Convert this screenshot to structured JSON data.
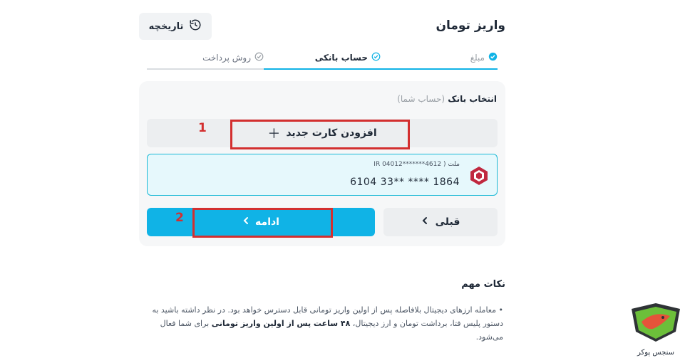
{
  "page": {
    "title": "واریز تومان"
  },
  "header": {
    "history_label": "تاریخچه",
    "history_icon": "history-icon"
  },
  "steps": [
    {
      "label": "مبلغ",
      "state": "done"
    },
    {
      "label": "حساب بانکی",
      "state": "active"
    },
    {
      "label": "روش پرداخت",
      "state": "pending"
    }
  ],
  "bank_select": {
    "title": "انتخاب بانک",
    "subtitle": "(حساب شما)"
  },
  "add_card": {
    "label": "افزودن کارت جدید",
    "icon": "plus-icon"
  },
  "saved_card": {
    "bank_name": "ملت",
    "iban_label": "( IR 04012*******4612",
    "card_number": "6104 33** **** 1864",
    "logo": "mellat-bank-logo"
  },
  "actions": {
    "continue_label": "ادامه",
    "previous_label": "قبلی"
  },
  "annotations": {
    "marker_1": "1",
    "marker_2": "2"
  },
  "notes": {
    "title": "نکات مهم",
    "text_part1": "معامله ارزهای دیجیتال بلافاصله پس از اولین واریز تومانی قابل دسترس خواهد بود. در نظر داشته باشید به دستور پلیس فتا، برداشت تومان و ارز دیجیتال، ",
    "text_bold": "۴۸ ساعت پس از اولین واریز تومانی",
    "text_part2": " برای شما فعال می‌شود."
  },
  "watermark": {
    "text": "سنجس پوکر"
  },
  "colors": {
    "accent": "#10b3e6",
    "highlight_border": "#d32f2f",
    "card_border": "#1ab9d6"
  }
}
